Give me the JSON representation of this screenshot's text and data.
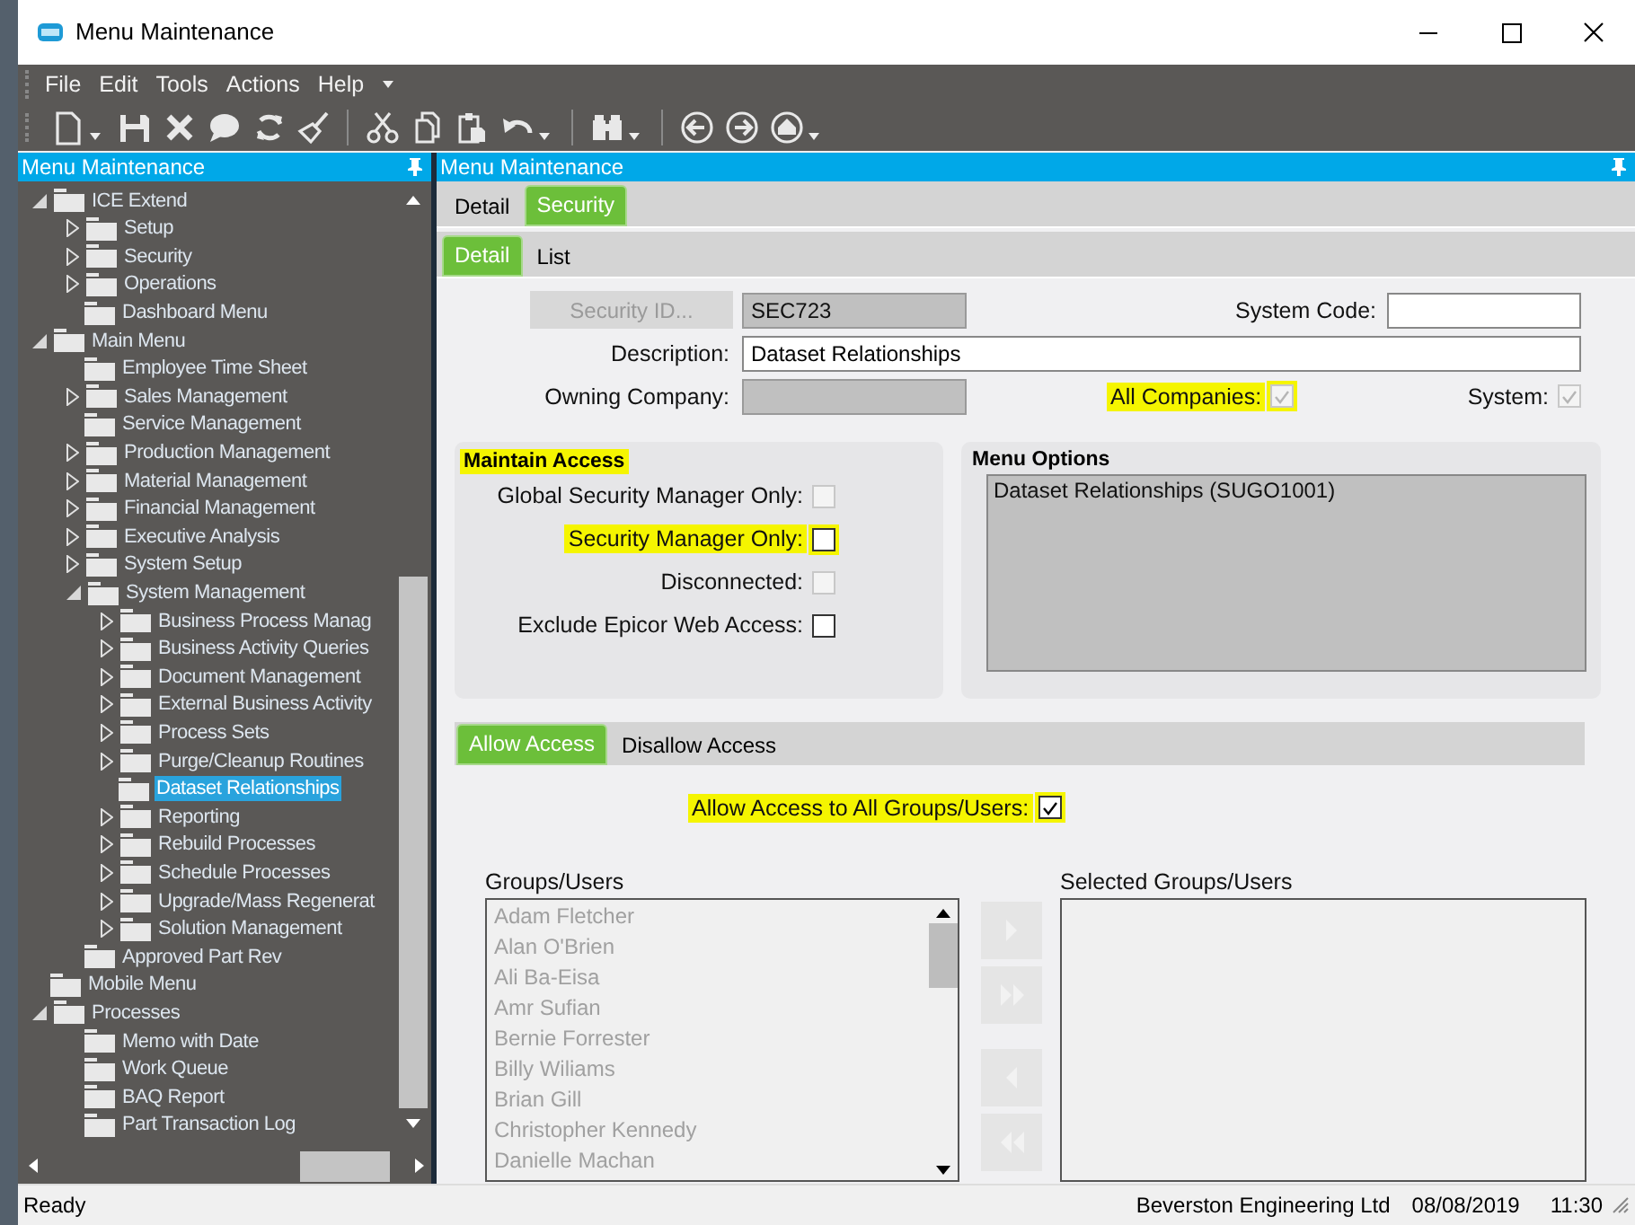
{
  "window": {
    "title": "Menu Maintenance"
  },
  "menu_bar": [
    "File",
    "Edit",
    "Tools",
    "Actions",
    "Help"
  ],
  "tree_panel": {
    "title": "Menu Maintenance",
    "items": [
      {
        "label": "ICE Extend",
        "kind": "branch",
        "expanded": true,
        "selected": false,
        "children": [
          {
            "label": "Setup",
            "kind": "branch",
            "expanded": false,
            "selected": false
          },
          {
            "label": "Security",
            "kind": "branch",
            "expanded": false,
            "selected": false
          },
          {
            "label": "Operations",
            "kind": "branch",
            "expanded": false,
            "selected": false
          },
          {
            "label": "Dashboard Menu",
            "kind": "leaf",
            "selected": false
          }
        ]
      },
      {
        "label": "Main Menu",
        "kind": "branch",
        "expanded": true,
        "selected": false,
        "children": [
          {
            "label": "Employee Time Sheet",
            "kind": "leaf",
            "selected": false
          },
          {
            "label": "Sales Management",
            "kind": "branch",
            "expanded": false,
            "selected": false
          },
          {
            "label": "Service Management",
            "kind": "leaf",
            "selected": false
          },
          {
            "label": "Production Management",
            "kind": "branch",
            "expanded": false,
            "selected": false
          },
          {
            "label": "Material Management",
            "kind": "branch",
            "expanded": false,
            "selected": false
          },
          {
            "label": "Financial Management",
            "kind": "branch",
            "expanded": false,
            "selected": false
          },
          {
            "label": "Executive Analysis",
            "kind": "branch",
            "expanded": false,
            "selected": false
          },
          {
            "label": "System Setup",
            "kind": "branch",
            "expanded": false,
            "selected": false
          },
          {
            "label": "System Management",
            "kind": "branch",
            "expanded": true,
            "selected": false,
            "children": [
              {
                "label": "Business Process Manag",
                "kind": "branch",
                "expanded": false,
                "selected": false
              },
              {
                "label": "Business Activity Queries",
                "kind": "branch",
                "expanded": false,
                "selected": false
              },
              {
                "label": "Document Management",
                "kind": "branch",
                "expanded": false,
                "selected": false
              },
              {
                "label": "External Business Activity",
                "kind": "branch",
                "expanded": false,
                "selected": false
              },
              {
                "label": "Process Sets",
                "kind": "branch",
                "expanded": false,
                "selected": false
              },
              {
                "label": "Purge/Cleanup Routines",
                "kind": "branch",
                "expanded": false,
                "selected": false
              },
              {
                "label": "Dataset Relationships",
                "kind": "leaf",
                "selected": true
              },
              {
                "label": "Reporting",
                "kind": "branch",
                "expanded": false,
                "selected": false
              },
              {
                "label": "Rebuild Processes",
                "kind": "branch",
                "expanded": false,
                "selected": false
              },
              {
                "label": "Schedule Processes",
                "kind": "branch",
                "expanded": false,
                "selected": false
              },
              {
                "label": "Upgrade/Mass Regenerat",
                "kind": "branch",
                "expanded": false,
                "selected": false
              },
              {
                "label": "Solution Management",
                "kind": "branch",
                "expanded": false,
                "selected": false
              }
            ]
          },
          {
            "label": "Approved Part Rev",
            "kind": "leaf",
            "selected": false
          }
        ]
      },
      {
        "label": "Mobile Menu",
        "kind": "leaf",
        "selected": false
      },
      {
        "label": "Processes",
        "kind": "branch",
        "expanded": true,
        "selected": false,
        "children": [
          {
            "label": "Memo with Date",
            "kind": "leaf",
            "selected": false
          },
          {
            "label": "Work Queue",
            "kind": "leaf",
            "selected": false
          },
          {
            "label": "BAQ Report",
            "kind": "leaf",
            "selected": false
          },
          {
            "label": "Part Transaction Log",
            "kind": "leaf",
            "selected": false
          }
        ]
      }
    ]
  },
  "detail_panel": {
    "title": "Menu Maintenance",
    "tabs": [
      {
        "label": "Detail",
        "selected": false
      },
      {
        "label": "Security",
        "selected": true
      }
    ],
    "sub_tabs": [
      {
        "label": "Detail",
        "selected": true
      },
      {
        "label": "List",
        "selected": false
      }
    ],
    "security_id_button": {
      "label": "Security ID...",
      "disabled": true
    },
    "security_id": {
      "value": "SEC723",
      "disabled": true
    },
    "system_code": {
      "label": "System Code:"
    },
    "description": {
      "label": "Description:",
      "value": "Dataset Relationships"
    },
    "owning_company": {
      "label": "Owning Company:",
      "disabled": true
    },
    "all_companies": {
      "label": "All Companies:",
      "checked": true,
      "disabled": true,
      "highlighted": true
    },
    "system": {
      "label": "System:",
      "checked": true,
      "disabled": true,
      "highlighted": false
    },
    "maintain_access": {
      "title": "Maintain Access",
      "highlighted": true,
      "options": [
        {
          "label": "Global Security Manager Only:",
          "checked": false,
          "disabled": true,
          "highlighted": false
        },
        {
          "label": "Security Manager Only:",
          "checked": false,
          "disabled": false,
          "highlighted": true
        },
        {
          "label": "Disconnected:",
          "checked": false,
          "disabled": true,
          "highlighted": false
        },
        {
          "label": "Exclude Epicor Web Access:",
          "checked": false,
          "disabled": false,
          "highlighted": false
        }
      ]
    },
    "menu_options": {
      "title": "Menu Options",
      "items": [
        "Dataset Relationships (SUGO1001)"
      ]
    },
    "access_tabs": [
      {
        "label": "Allow Access",
        "selected": true
      },
      {
        "label": "Disallow Access",
        "selected": false
      }
    ],
    "allow_all": {
      "label": "Allow Access to All Groups/Users:",
      "checked": true,
      "disabled": false,
      "highlighted": true
    },
    "groups_users": {
      "label": "Groups/Users",
      "disabled": true,
      "items": [
        "Adam Fletcher",
        "Alan O'Brien",
        "Ali Ba-Eisa",
        "Amr Sufian",
        "Bernie Forrester",
        "Billy Wiliams",
        "Brian Gill",
        "Christopher Kennedy",
        "Danielle Machan"
      ]
    },
    "transfer_buttons": [
      {
        "kind": "add",
        "disabled": true
      },
      {
        "kind": "add-all",
        "disabled": true
      },
      {
        "kind": "remove",
        "disabled": true
      },
      {
        "kind": "remove-all",
        "disabled": true
      }
    ],
    "selected_groups_users": {
      "label": "Selected Groups/Users"
    }
  },
  "status_bar": {
    "status": "Ready",
    "company": "Beverston Engineering Ltd",
    "date": "08/08/2019",
    "time": "11:30"
  }
}
